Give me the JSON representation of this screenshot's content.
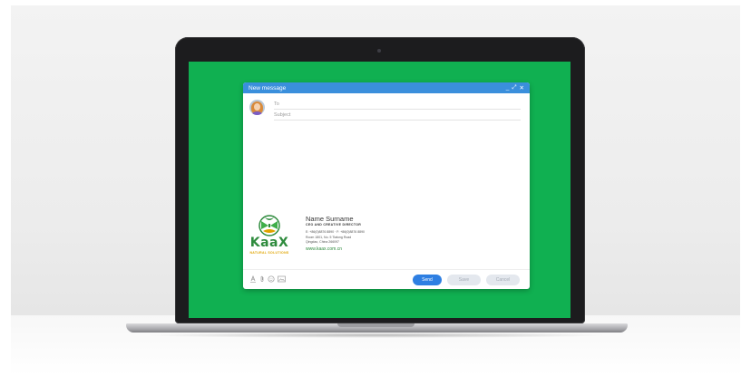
{
  "compose": {
    "title": "New message",
    "controls": {
      "minimize": "_",
      "expand": "⤢",
      "close": "✕"
    },
    "to_placeholder": "To",
    "subject_placeholder": "Subject"
  },
  "signature": {
    "logo_text": "KaaX",
    "logo_tagline": "NATURAL SOLUTIONS",
    "name": "Name Surname",
    "role": "CEO AND CREATIVE DIRECTOR",
    "phones": "E: +86(0)8876 8890 · F: +86(0)8876 8890",
    "address_line1": "Room 1801, No. 5 Tiatong Road",
    "address_line2": "Qingdao, China 266097",
    "website": "www.kaax.com.cn"
  },
  "toolbar": {
    "icons": [
      "text-format-icon",
      "attachment-icon",
      "emoji-icon",
      "image-icon"
    ],
    "send_label": "Send",
    "save_label": "Save",
    "cancel_label": "Cancel"
  },
  "colors": {
    "screen_background": "#10b051",
    "titlebar": "#3a8fdc",
    "send_button": "#2e7fe2",
    "brand_green": "#2e8b3d"
  }
}
